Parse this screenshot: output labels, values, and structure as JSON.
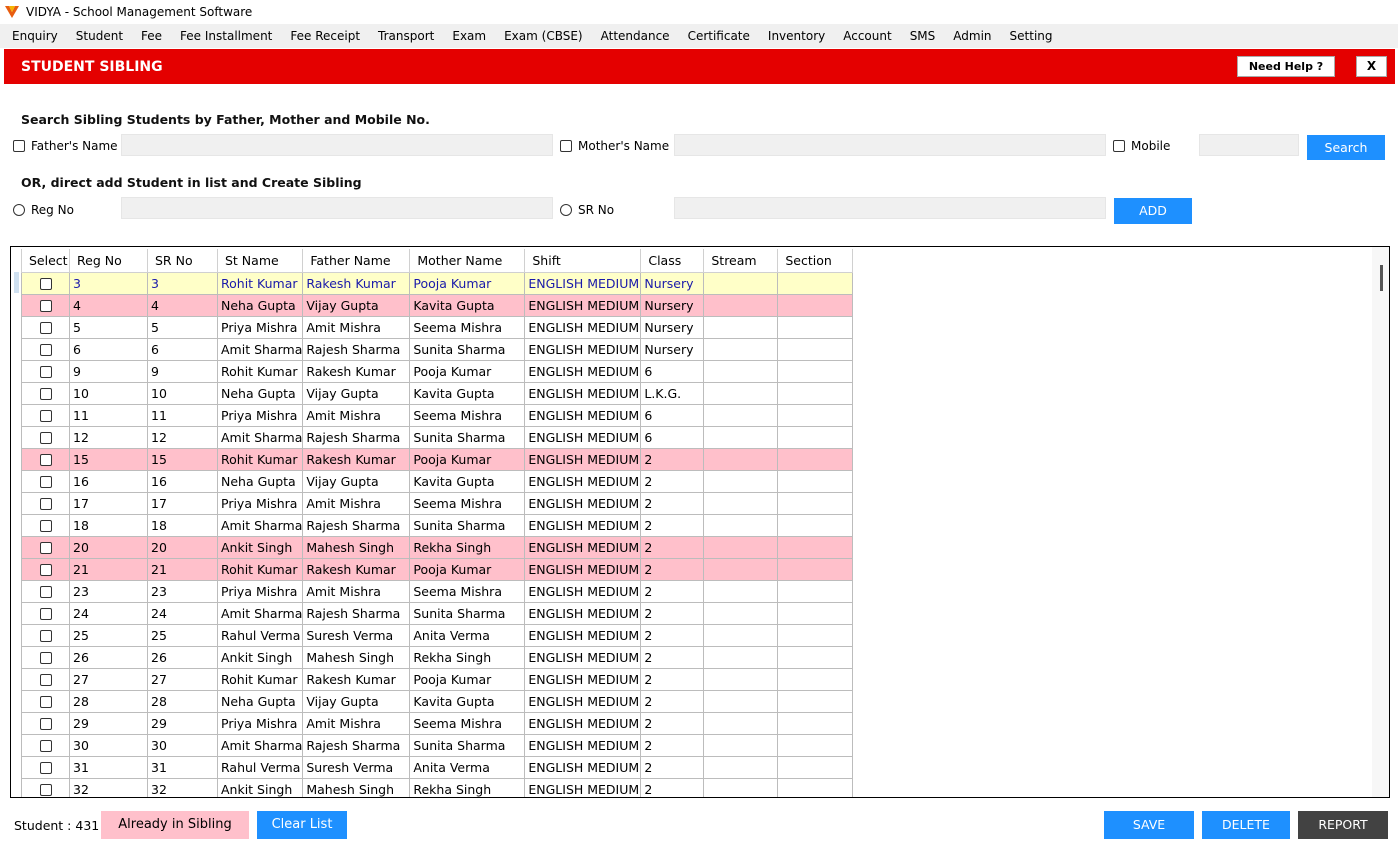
{
  "window": {
    "title": "VIDYA - School Management Software"
  },
  "menu": [
    "Enquiry",
    "Student",
    "Fee",
    "Fee Installment",
    "Fee Receipt",
    "Transport",
    "Exam",
    "Exam (CBSE)",
    "Attendance",
    "Certificate",
    "Inventory",
    "Account",
    "SMS",
    "Admin",
    "Setting"
  ],
  "header": {
    "title": "STUDENT SIBLING",
    "help_label": "Need Help ?",
    "close_label": "X"
  },
  "search": {
    "title": "Search Sibling Students by Father, Mother and Mobile No.",
    "father_label": "Father's Name",
    "mother_label": "Mother's Name",
    "mobile_label": "Mobile",
    "father_value": "",
    "mother_value": "",
    "mobile_value": "",
    "button_label": "Search"
  },
  "direct": {
    "title": "OR, direct add Student in list and Create Sibling",
    "reg_label": "Reg No",
    "sr_label": "SR No",
    "reg_value": "",
    "sr_value": "",
    "button_label": "ADD"
  },
  "grid": {
    "columns": [
      "Select",
      "Reg No",
      "SR No",
      "St Name",
      "Father Name",
      "Mother Name",
      "Shift",
      "Class",
      "Stream",
      "Section"
    ],
    "rows": [
      {
        "reg": "3",
        "sr": "3",
        "name": "Rohit Kumar",
        "father": "Rakesh Kumar",
        "mother": "Pooja Kumar",
        "shift": "ENGLISH MEDIUM",
        "class": "Nursery",
        "stream": "",
        "section": "",
        "hl": "yellow"
      },
      {
        "reg": "4",
        "sr": "4",
        "name": "Neha Gupta",
        "father": "Vijay Gupta",
        "mother": "Kavita Gupta",
        "shift": "ENGLISH MEDIUM",
        "class": "Nursery",
        "stream": "",
        "section": "",
        "hl": "pink"
      },
      {
        "reg": "5",
        "sr": "5",
        "name": "Priya Mishra",
        "father": "Amit Mishra",
        "mother": "Seema Mishra",
        "shift": "ENGLISH MEDIUM",
        "class": "Nursery",
        "stream": "",
        "section": "",
        "hl": ""
      },
      {
        "reg": "6",
        "sr": "6",
        "name": "Amit Sharma",
        "father": "Rajesh Sharma",
        "mother": "Sunita Sharma",
        "shift": "ENGLISH MEDIUM",
        "class": "Nursery",
        "stream": "",
        "section": "",
        "hl": ""
      },
      {
        "reg": "9",
        "sr": "9",
        "name": "Rohit Kumar",
        "father": "Rakesh Kumar",
        "mother": "Pooja Kumar",
        "shift": "ENGLISH MEDIUM",
        "class": "6",
        "stream": "",
        "section": "",
        "hl": ""
      },
      {
        "reg": "10",
        "sr": "10",
        "name": "Neha Gupta",
        "father": "Vijay Gupta",
        "mother": "Kavita Gupta",
        "shift": "ENGLISH MEDIUM",
        "class": "L.K.G.",
        "stream": "",
        "section": "",
        "hl": ""
      },
      {
        "reg": "11",
        "sr": "11",
        "name": "Priya Mishra",
        "father": "Amit Mishra",
        "mother": "Seema Mishra",
        "shift": "ENGLISH MEDIUM",
        "class": "6",
        "stream": "",
        "section": "",
        "hl": ""
      },
      {
        "reg": "12",
        "sr": "12",
        "name": "Amit Sharma",
        "father": "Rajesh Sharma",
        "mother": "Sunita Sharma",
        "shift": "ENGLISH MEDIUM",
        "class": "6",
        "stream": "",
        "section": "",
        "hl": ""
      },
      {
        "reg": "15",
        "sr": "15",
        "name": "Rohit Kumar",
        "father": "Rakesh Kumar",
        "mother": "Pooja Kumar",
        "shift": "ENGLISH MEDIUM",
        "class": "2",
        "stream": "",
        "section": "",
        "hl": "pink"
      },
      {
        "reg": "16",
        "sr": "16",
        "name": "Neha Gupta",
        "father": "Vijay Gupta",
        "mother": "Kavita Gupta",
        "shift": "ENGLISH MEDIUM",
        "class": "2",
        "stream": "",
        "section": "",
        "hl": ""
      },
      {
        "reg": "17",
        "sr": "17",
        "name": "Priya Mishra",
        "father": "Amit Mishra",
        "mother": "Seema Mishra",
        "shift": "ENGLISH MEDIUM",
        "class": "2",
        "stream": "",
        "section": "",
        "hl": ""
      },
      {
        "reg": "18",
        "sr": "18",
        "name": "Amit Sharma",
        "father": "Rajesh Sharma",
        "mother": "Sunita Sharma",
        "shift": "ENGLISH MEDIUM",
        "class": "2",
        "stream": "",
        "section": "",
        "hl": ""
      },
      {
        "reg": "20",
        "sr": "20",
        "name": "Ankit Singh",
        "father": "Mahesh Singh",
        "mother": "Rekha Singh",
        "shift": "ENGLISH MEDIUM",
        "class": "2",
        "stream": "",
        "section": "",
        "hl": "pink"
      },
      {
        "reg": "21",
        "sr": "21",
        "name": "Rohit Kumar",
        "father": "Rakesh Kumar",
        "mother": "Pooja Kumar",
        "shift": "ENGLISH MEDIUM",
        "class": "2",
        "stream": "",
        "section": "",
        "hl": "pink"
      },
      {
        "reg": "23",
        "sr": "23",
        "name": "Priya Mishra",
        "father": "Amit Mishra",
        "mother": "Seema Mishra",
        "shift": "ENGLISH MEDIUM",
        "class": "2",
        "stream": "",
        "section": "",
        "hl": ""
      },
      {
        "reg": "24",
        "sr": "24",
        "name": "Amit Sharma",
        "father": "Rajesh Sharma",
        "mother": "Sunita Sharma",
        "shift": "ENGLISH MEDIUM",
        "class": "2",
        "stream": "",
        "section": "",
        "hl": ""
      },
      {
        "reg": "25",
        "sr": "25",
        "name": "Rahul Verma",
        "father": "Suresh Verma",
        "mother": "Anita Verma",
        "shift": "ENGLISH MEDIUM",
        "class": "2",
        "stream": "",
        "section": "",
        "hl": ""
      },
      {
        "reg": "26",
        "sr": "26",
        "name": "Ankit Singh",
        "father": "Mahesh Singh",
        "mother": "Rekha Singh",
        "shift": "ENGLISH MEDIUM",
        "class": "2",
        "stream": "",
        "section": "",
        "hl": ""
      },
      {
        "reg": "27",
        "sr": "27",
        "name": "Rohit Kumar",
        "father": "Rakesh Kumar",
        "mother": "Pooja Kumar",
        "shift": "ENGLISH MEDIUM",
        "class": "2",
        "stream": "",
        "section": "",
        "hl": ""
      },
      {
        "reg": "28",
        "sr": "28",
        "name": "Neha Gupta",
        "father": "Vijay Gupta",
        "mother": "Kavita Gupta",
        "shift": "ENGLISH MEDIUM",
        "class": "2",
        "stream": "",
        "section": "",
        "hl": ""
      },
      {
        "reg": "29",
        "sr": "29",
        "name": "Priya Mishra",
        "father": "Amit Mishra",
        "mother": "Seema Mishra",
        "shift": "ENGLISH MEDIUM",
        "class": "2",
        "stream": "",
        "section": "",
        "hl": ""
      },
      {
        "reg": "30",
        "sr": "30",
        "name": "Amit Sharma",
        "father": "Rajesh Sharma",
        "mother": "Sunita Sharma",
        "shift": "ENGLISH MEDIUM",
        "class": "2",
        "stream": "",
        "section": "",
        "hl": ""
      },
      {
        "reg": "31",
        "sr": "31",
        "name": "Rahul Verma",
        "father": "Suresh Verma",
        "mother": "Anita Verma",
        "shift": "ENGLISH MEDIUM",
        "class": "2",
        "stream": "",
        "section": "",
        "hl": ""
      },
      {
        "reg": "32",
        "sr": "32",
        "name": "Ankit Singh",
        "father": "Mahesh Singh",
        "mother": "Rekha Singh",
        "shift": "ENGLISH MEDIUM",
        "class": "2",
        "stream": "",
        "section": "",
        "hl": ""
      }
    ]
  },
  "footer": {
    "count_label": "Student : 431",
    "legend_label": "Already in Sibling",
    "clear_label": "Clear List",
    "save_label": "SAVE",
    "delete_label": "DELETE",
    "report_label": "REPORT"
  },
  "colors": {
    "header_red": "#e40000",
    "button_blue": "#1e90ff",
    "sibling_pink": "#ffc0cb",
    "selected_yellow": "#ffffc8",
    "report_dark": "#424242"
  },
  "icons": {
    "app": "vidya-logo-icon",
    "checkbox": "checkbox-icon",
    "radio": "radio-icon"
  }
}
